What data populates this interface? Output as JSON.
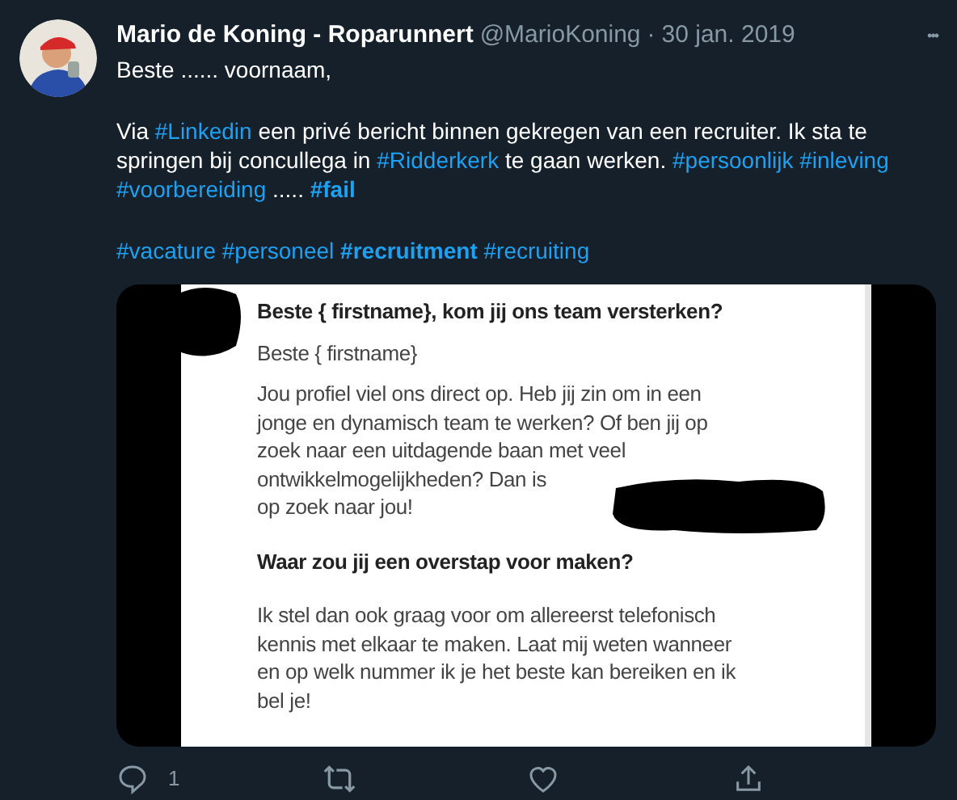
{
  "tweet": {
    "author": "Mario de Koning - Roparunnert",
    "handle": "@MarioKoning",
    "separator": "·",
    "date": "30 jan. 2019",
    "more": "•••",
    "paragraphs": [
      [
        {
          "kind": "text",
          "text": "Beste ...... voornaam,"
        }
      ],
      [
        {
          "kind": "text",
          "text": "Via "
        },
        {
          "kind": "hashtag",
          "text": "#Linkedin"
        },
        {
          "kind": "text",
          "text": " een privé bericht binnen gekregen van een recruiter. Ik sta te springen bij concullega in "
        },
        {
          "kind": "hashtag",
          "text": "#Ridderkerk"
        },
        {
          "kind": "text",
          "text": " te gaan werken. "
        },
        {
          "kind": "hashtag",
          "text": "#persoonlijk"
        },
        {
          "kind": "hashtag",
          "text": "#inleving"
        },
        {
          "kind": "hashtag",
          "text": "#voorbereiding"
        },
        {
          "kind": "text",
          "text": " ..... "
        },
        {
          "kind": "hashtag",
          "text": "#fail",
          "bold": true
        }
      ],
      [
        {
          "kind": "hashtag",
          "text": "#vacature"
        },
        {
          "kind": "hashtag",
          "text": "#personeel"
        },
        {
          "kind": "hashtag",
          "text": "#recruitment",
          "bold": true
        },
        {
          "kind": "hashtag",
          "text": "#recruiting"
        }
      ]
    ],
    "media": {
      "subject": "Beste { firstname}, kom jij ons team versterken?",
      "lines": [
        {
          "kind": "text",
          "text": "Beste { firstname}"
        },
        {
          "kind": "text",
          "text": "Jou profiel viel ons direct op. Heb jij zin om in een jonge en dynamisch team te werken? Of ben jij op zoek naar een uitdagende baan met veel ontwikkelmogelijkheden?  Dan is"
        },
        {
          "kind": "text",
          "text": "op zoek naar jou!"
        },
        {
          "kind": "heading",
          "text": "Waar zou jij een overstap voor maken?"
        },
        {
          "kind": "text",
          "text": "Ik stel dan ook graag voor om allereerst telefonisch kennis met elkaar te maken. Laat mij weten wanneer en op welk nummer ik je het beste kan bereiken en ik bel je!"
        }
      ]
    },
    "actions": [
      {
        "kind": "reply",
        "count": "1"
      },
      {
        "kind": "retweet"
      },
      {
        "kind": "like"
      },
      {
        "kind": "share"
      }
    ]
  }
}
